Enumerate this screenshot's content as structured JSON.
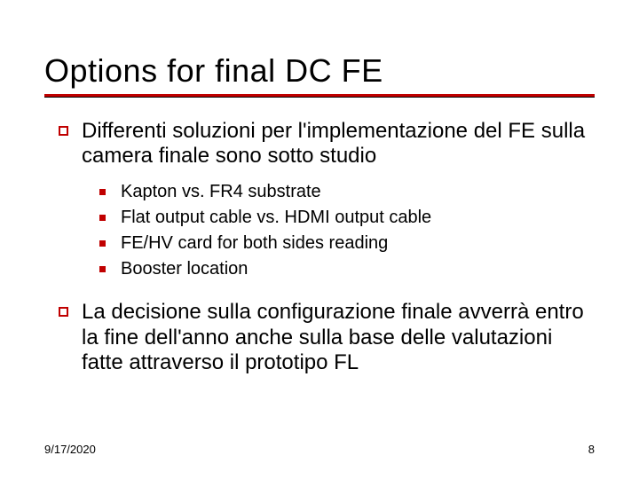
{
  "title": "Options for final DC FE",
  "bullets": [
    {
      "text": "Differenti soluzioni per l'implementazione del FE sulla camera finale sono sotto studio",
      "sub": [
        "Kapton vs. FR4 substrate",
        "Flat output cable vs. HDMI output cable",
        "FE/HV card for both sides reading",
        "Booster location"
      ]
    },
    {
      "text": "La decisione sulla configurazione finale avverrà entro la fine dell'anno anche sulla base delle valutazioni fatte attraverso il prototipo FL",
      "sub": []
    }
  ],
  "footer": {
    "date": "9/17/2020",
    "page": "8"
  }
}
